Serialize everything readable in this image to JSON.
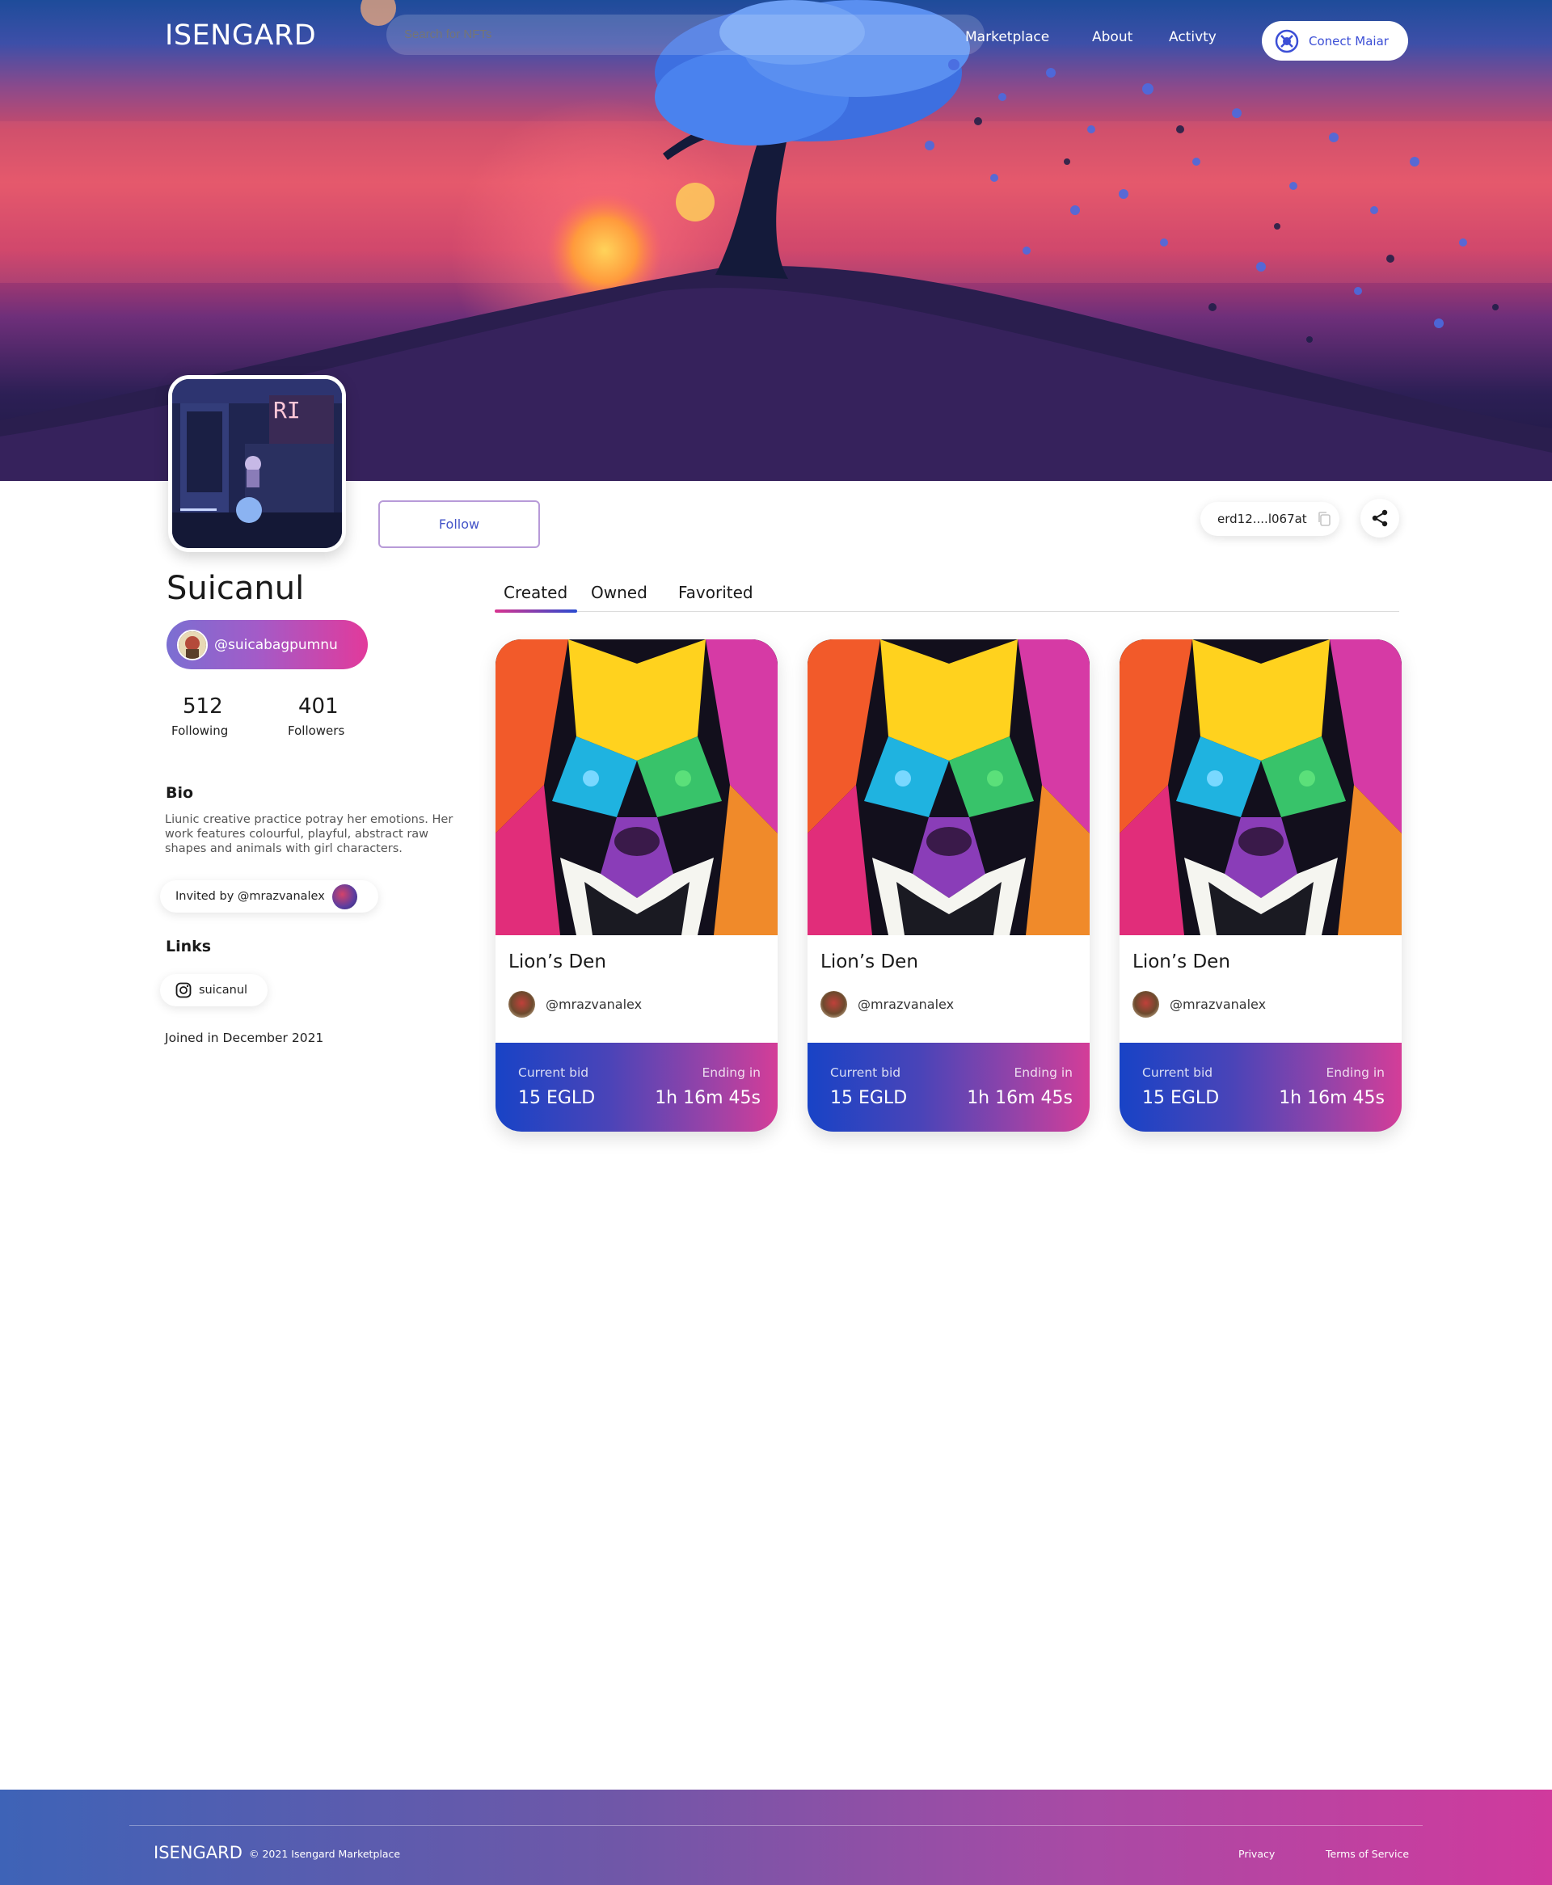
{
  "header": {
    "brand": "ISENGARD",
    "search_placeholder": "Search for NFTs",
    "nav": {
      "marketplace": "Marketplace",
      "about": "About",
      "activity": "Activty"
    },
    "connect_label": "Conect Maiar"
  },
  "profile": {
    "follow_label": "Follow",
    "wallet_address": "erd12....l067at",
    "name": "Suicanul",
    "handle": "@suicabagpumnu",
    "stats": {
      "following_count": "512",
      "following_label": "Following",
      "followers_count": "401",
      "followers_label": "Followers"
    },
    "bio_heading": "Bio",
    "bio_text": "Liunic creative practice potray her emotions. Her work features colourful, playful, abstract raw shapes and animals with girl characters.",
    "invited_by": "Invited by @mrazvanalex",
    "links_heading": "Links",
    "link_label": "suicanul",
    "joined": "Joined in December 2021"
  },
  "tabs": [
    "Created",
    "Owned",
    "Favorited"
  ],
  "cards": [
    {
      "title": "Lion’s Den",
      "owner": "@mrazvanalex",
      "bid_label": "Current bid",
      "bid_value": "15 EGLD",
      "end_label": "Ending in",
      "end_value": "1h 16m 45s"
    },
    {
      "title": "Lion’s Den",
      "owner": "@mrazvanalex",
      "bid_label": "Current bid",
      "bid_value": "15 EGLD",
      "end_label": "Ending in",
      "end_value": "1h 16m 45s"
    },
    {
      "title": "Lion’s Den",
      "owner": "@mrazvanalex",
      "bid_label": "Current bid",
      "bid_value": "15 EGLD",
      "end_label": "Ending in",
      "end_value": "1h 16m 45s"
    }
  ],
  "footer": {
    "brand": "ISENGARD",
    "copyright": "© 2021 Isengard Marketplace",
    "privacy": "Privacy",
    "terms": "Terms of Service"
  },
  "colors": {
    "accent_blue": "#3c4fd6",
    "accent_pink": "#d43d98",
    "card_footer_start": "#1843c6",
    "card_footer_end": "#d43d98"
  }
}
